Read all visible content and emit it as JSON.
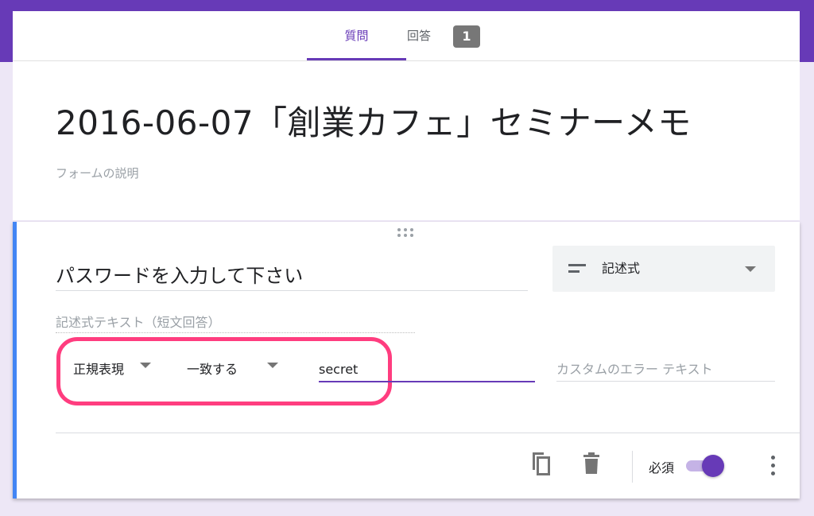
{
  "colors": {
    "brand": "#673ab7",
    "accent": "#4285f4",
    "highlight": "#ff3d7f"
  },
  "tabs": {
    "questions": "質問",
    "responses": "回答",
    "responses_count": "1"
  },
  "form": {
    "title": "2016-06-07「創業カフェ」セミナーメモ",
    "description_placeholder": "フォームの説明"
  },
  "question": {
    "title": "パスワードを入力して下さい",
    "type_label": "記述式",
    "type_icon": "short-answer-icon",
    "answer_placeholder": "記述式テキスト（短文回答）",
    "validation": {
      "type": "正規表現",
      "condition": "一致する",
      "pattern": "secret",
      "error_placeholder": "カスタムのエラー テキスト"
    },
    "footer": {
      "duplicate_icon": "copy-icon",
      "delete_icon": "trash-icon",
      "required_label": "必須",
      "required_on": true,
      "more_icon": "more-vert-icon"
    }
  }
}
